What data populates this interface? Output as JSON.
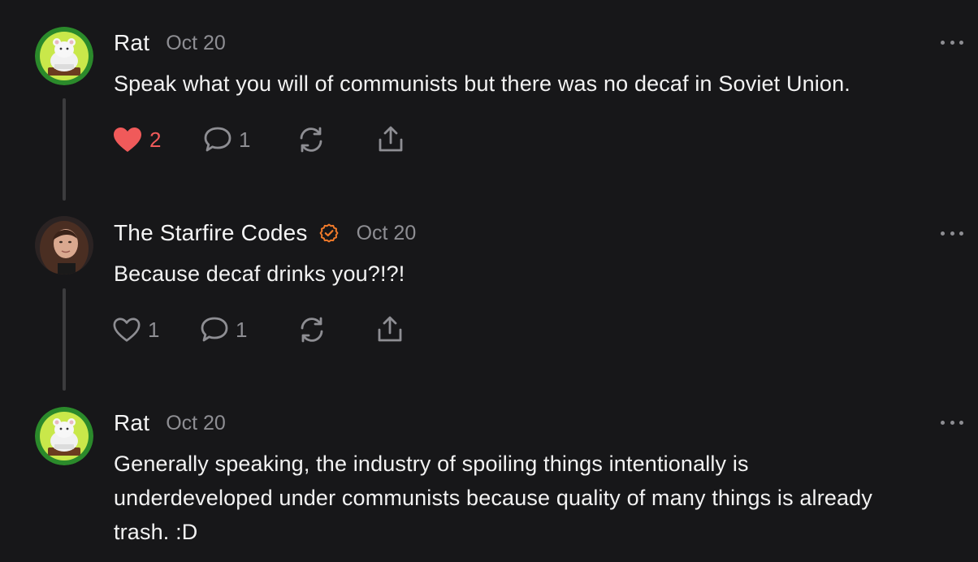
{
  "colors": {
    "background": "#171719",
    "text_primary": "#f2f2f2",
    "text_secondary": "#8e8e93",
    "like_active": "#f05a5a",
    "verified_badge": "#f07a2a",
    "thread_line": "#3c3c3e"
  },
  "posts": [
    {
      "author": "Rat",
      "date": "Oct 20",
      "verified": false,
      "avatar_icon": "rat-avatar-icon",
      "text": "Speak what you will of communists but there was no decaf in Soviet Union.",
      "likes": "2",
      "liked": true,
      "replies": "1"
    },
    {
      "author": "The Starfire Codes",
      "date": "Oct 20",
      "verified": true,
      "avatar_icon": "profile-photo-avatar",
      "text": "Because decaf drinks you?!?!",
      "likes": "1",
      "liked": false,
      "replies": "1"
    },
    {
      "author": "Rat",
      "date": "Oct 20",
      "verified": false,
      "avatar_icon": "rat-avatar-icon",
      "text": "Generally speaking, the industry of spoiling things intentionally is underdeveloped under communists because quality of many things is already trash. :D"
    }
  ]
}
